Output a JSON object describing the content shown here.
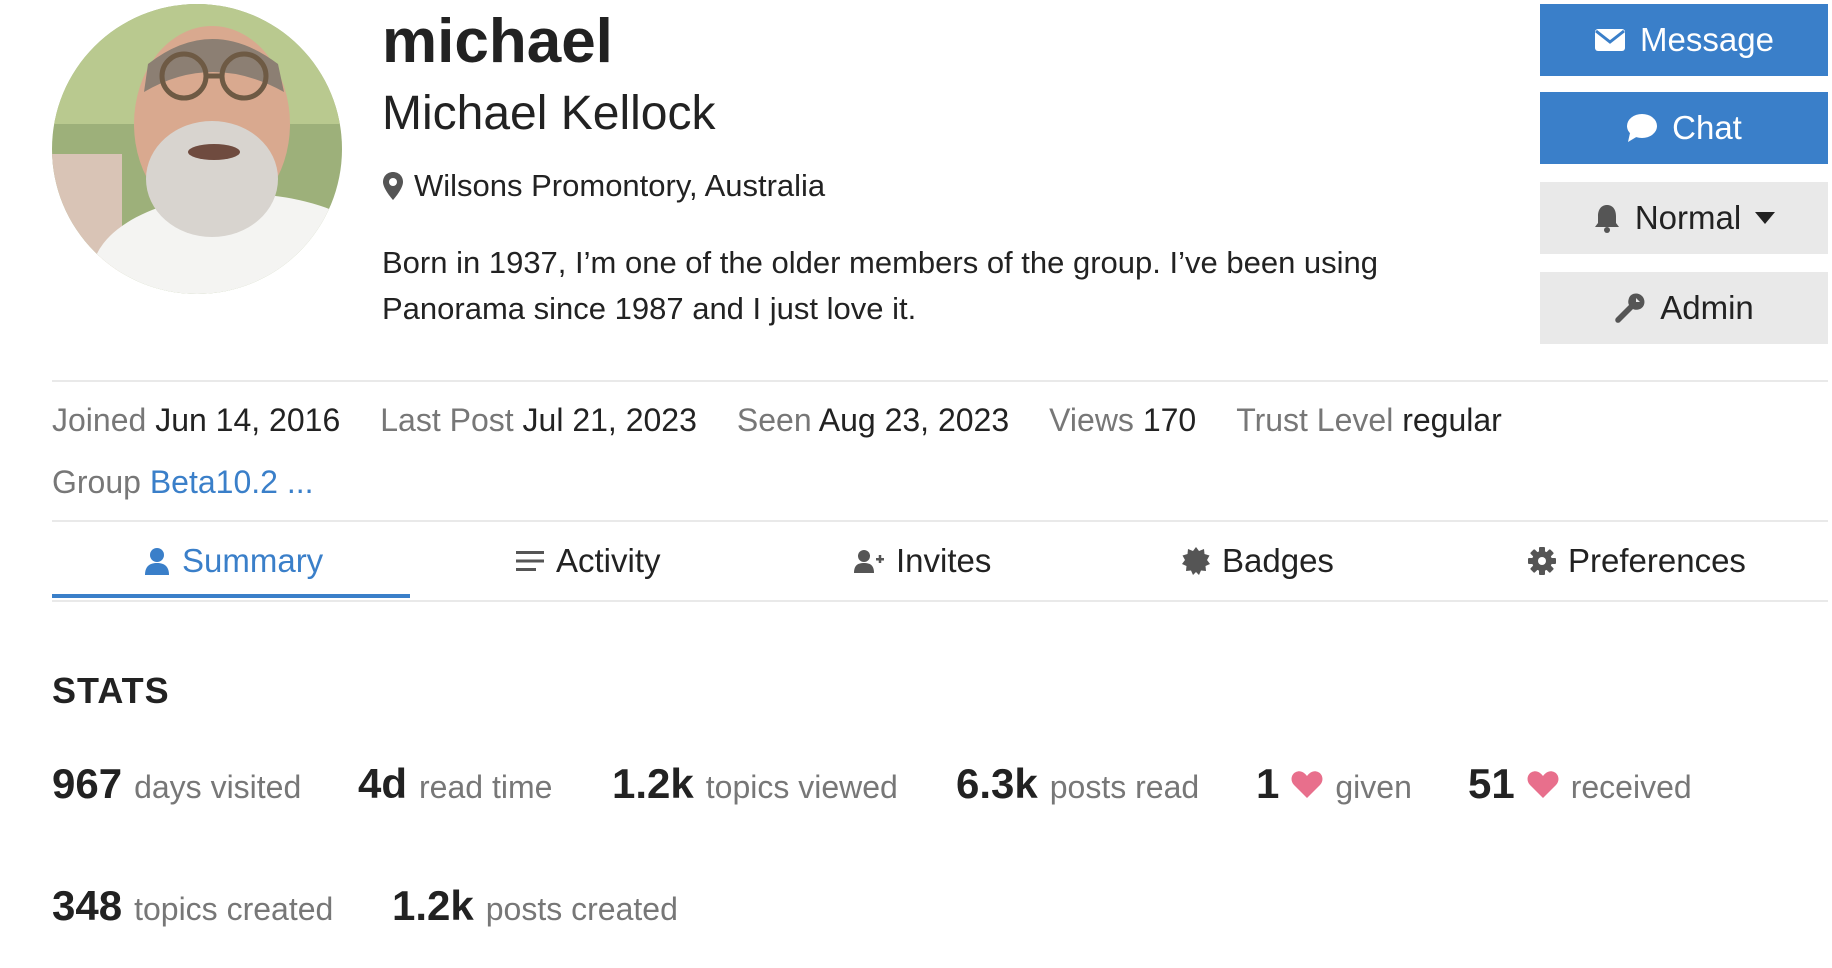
{
  "profile": {
    "username": "michael",
    "full_name": "Michael Kellock",
    "location": "Wilsons Promontory, Australia",
    "bio": "Born in 1937, I’m one of the older members of the group. I’ve been using Panorama since 1987 and I just love it."
  },
  "actions": {
    "message": "Message",
    "chat": "Chat",
    "notification_level": "Normal",
    "admin": "Admin"
  },
  "meta": {
    "joined_label": "Joined",
    "joined_value": "Jun 14, 2016",
    "last_post_label": "Last Post",
    "last_post_value": "Jul 21, 2023",
    "seen_label": "Seen",
    "seen_value": "Aug 23, 2023",
    "views_label": "Views",
    "views_value": "170",
    "trust_label": "Trust Level",
    "trust_value": "regular",
    "group_label": "Group",
    "group_value": "Beta10.2 ..."
  },
  "tabs": [
    {
      "label": "Summary",
      "icon": "user-icon",
      "active": true
    },
    {
      "label": "Activity",
      "icon": "list-icon",
      "active": false
    },
    {
      "label": "Invites",
      "icon": "user-plus-icon",
      "active": false
    },
    {
      "label": "Badges",
      "icon": "badge-icon",
      "active": false
    },
    {
      "label": "Preferences",
      "icon": "gear-icon",
      "active": false
    }
  ],
  "stats": {
    "title": "STATS",
    "items": [
      {
        "value": "967",
        "label": "days visited"
      },
      {
        "value": "4d",
        "label": "read time"
      },
      {
        "value": "1.2k",
        "label": "topics viewed"
      },
      {
        "value": "6.3k",
        "label": "posts read"
      },
      {
        "value": "1",
        "label": "given",
        "icon": "heart-icon"
      },
      {
        "value": "51",
        "label": "received",
        "icon": "heart-icon"
      },
      {
        "value": "348",
        "label": "topics created"
      },
      {
        "value": "1.2k",
        "label": "posts created"
      }
    ]
  },
  "colors": {
    "accent": "#3a7fc9",
    "heart": "#e45735",
    "muted_text": "#777777",
    "button_gray": "#e9e9e9"
  }
}
